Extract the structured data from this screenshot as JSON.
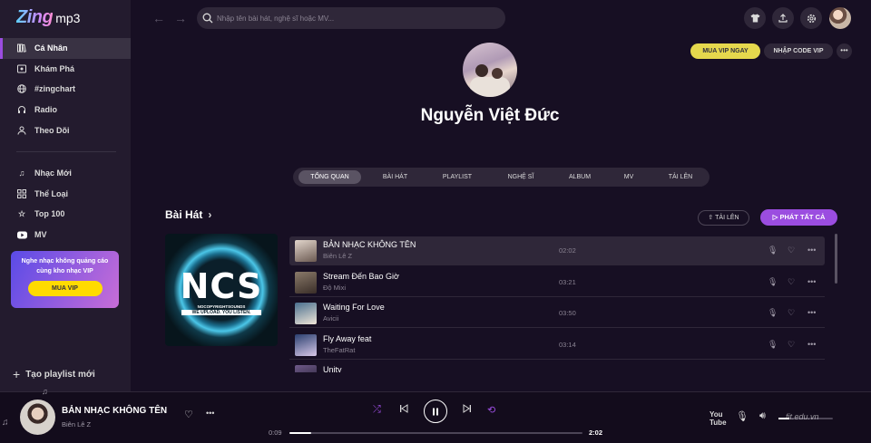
{
  "app": {
    "logo_main": "Zing",
    "logo_sub": "mp3"
  },
  "sidebar": {
    "items": [
      {
        "label": "Cá Nhân",
        "icon": "library-icon",
        "active": true
      },
      {
        "label": "Khám Phá",
        "icon": "disc-icon"
      },
      {
        "label": "#zingchart",
        "icon": "chart-icon"
      },
      {
        "label": "Radio",
        "icon": "radio-icon"
      },
      {
        "label": "Theo Dõi",
        "icon": "follow-icon"
      },
      {
        "label": "Nhạc Mới",
        "icon": "music-note-icon"
      },
      {
        "label": "Thể Loại",
        "icon": "category-icon"
      },
      {
        "label": "Top 100",
        "icon": "star-icon"
      },
      {
        "label": "MV",
        "icon": "youtube-icon"
      }
    ],
    "vip_promo": {
      "text": "Nghe nhạc không quảng cáo cùng kho nhạc VIP",
      "button": "MUA VIP"
    },
    "new_playlist": "Tạo playlist mới"
  },
  "header": {
    "search_placeholder": "Nhập tên bài hát, nghệ sĩ hoặc MV..."
  },
  "profile": {
    "name": "Nguyễn Việt Đức",
    "buy_vip": "MUA VIP NGAY",
    "vip_code": "NHẬP CODE VIP",
    "more": "•••"
  },
  "tabs": [
    {
      "label": "TỔNG QUAN",
      "active": true
    },
    {
      "label": "BÀI HÁT"
    },
    {
      "label": "PLAYLIST"
    },
    {
      "label": "NGHỆ SĨ"
    },
    {
      "label": "ALBUM"
    },
    {
      "label": "MV"
    },
    {
      "label": "TẢI LÊN"
    }
  ],
  "songs_section": {
    "title": "Bài Hát",
    "upload": "TẢI LÊN",
    "play_all": "PHÁT TẤT CẢ",
    "cover": {
      "logo": "NCS",
      "line1": "NOCOPYRIGHTSOUNDS",
      "line2": "WE UPLOAD. YOU LISTEN."
    },
    "songs": [
      {
        "title": "BẢN NHẠC KHÔNG TÊN",
        "artist": "Biên Lê Z",
        "duration": "02:02",
        "active": true
      },
      {
        "title": "Stream Đến Bao Giờ",
        "artist": "Độ Mixi",
        "duration": "03:21"
      },
      {
        "title": "Waiting For Love",
        "artist": "Avicii",
        "duration": "03:50"
      },
      {
        "title": "Fly Away feat",
        "artist": "TheFatRat",
        "duration": "03:14"
      },
      {
        "title": "Unity",
        "artist": "",
        "duration": ""
      }
    ]
  },
  "player": {
    "title": "BẢN NHẠC KHÔNG TÊN",
    "artist": "Biên Lê Z",
    "current_time": "0:09",
    "total_time": "2:02",
    "progress": 0.074,
    "volume": 0.2,
    "watermark": "fit.edu.vn"
  },
  "colors": {
    "background": "#170f23",
    "sidebar": "#231b2e",
    "accent": "#9b4de0",
    "vip_yellow": "#e5d84d"
  }
}
